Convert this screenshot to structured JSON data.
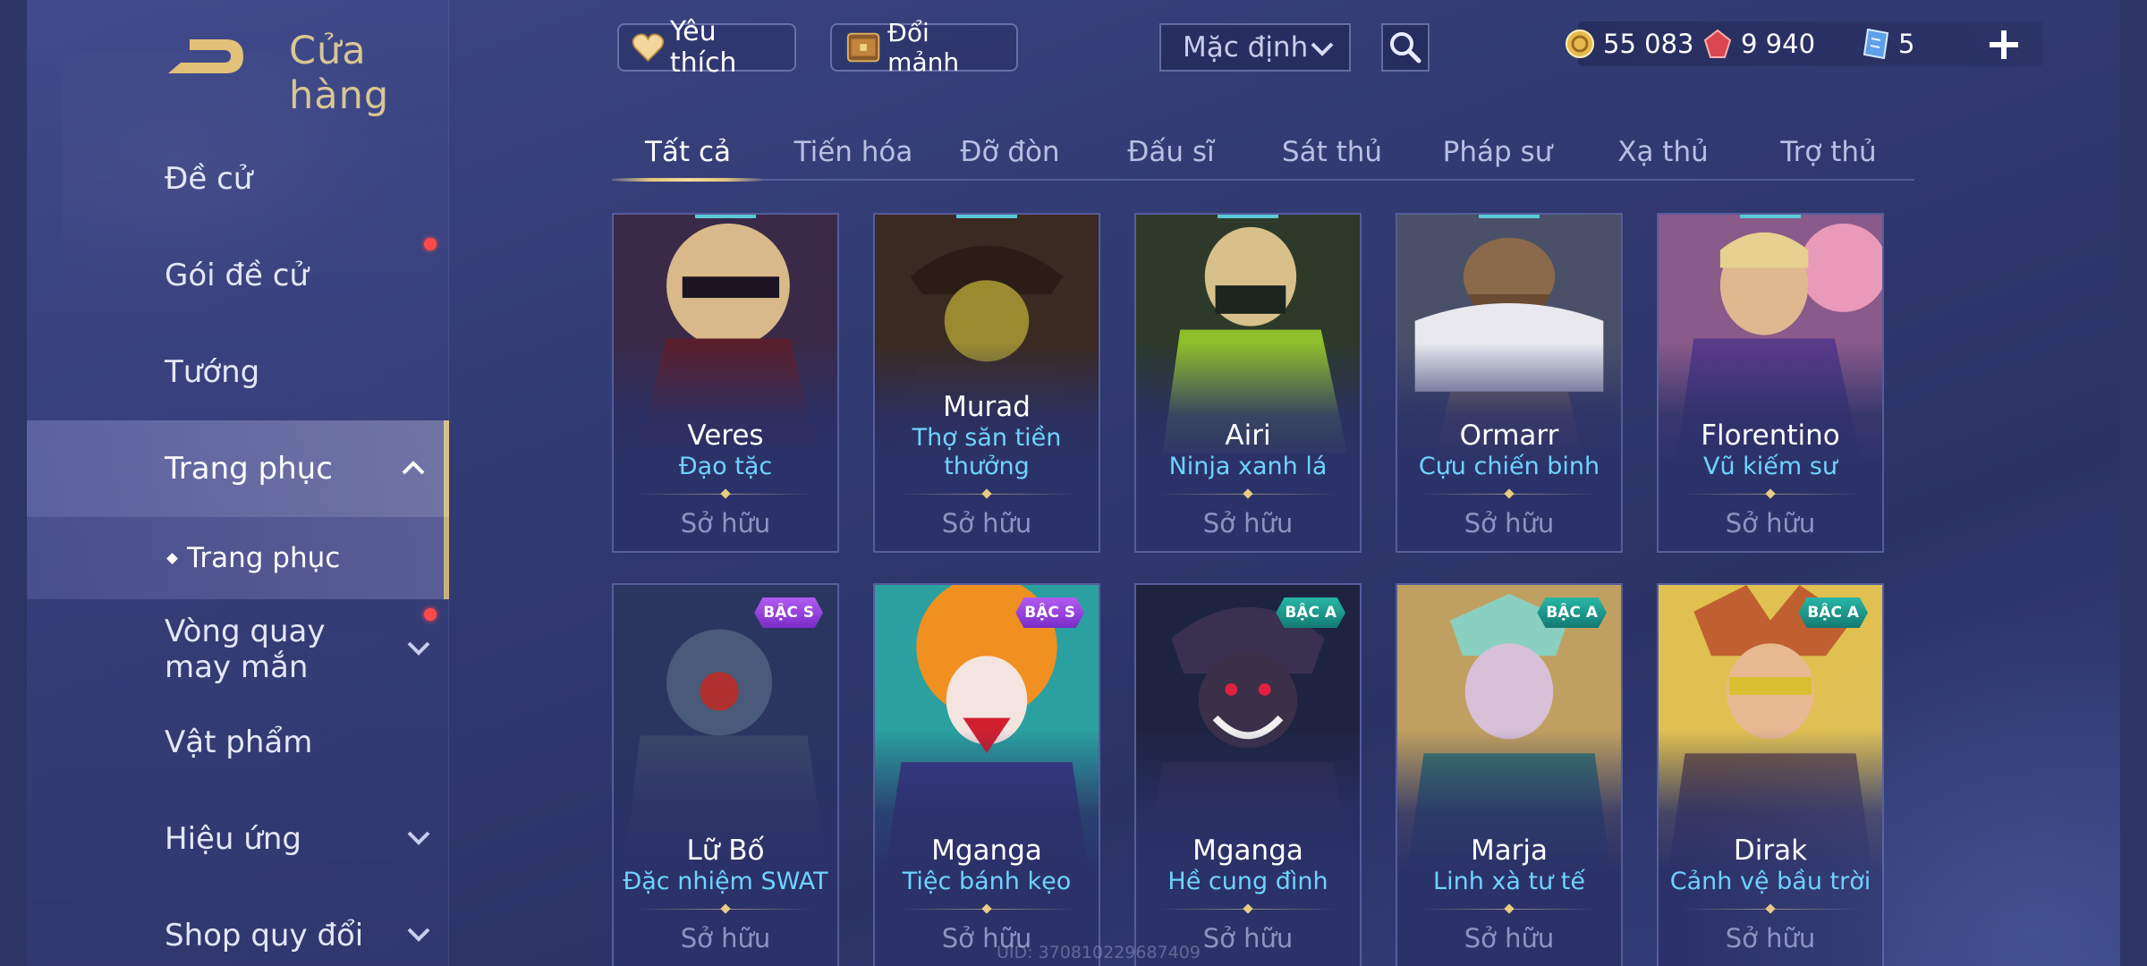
{
  "header": {
    "title": "Cửa hàng"
  },
  "sidebar": {
    "items": [
      {
        "label": "Đề cử"
      },
      {
        "label": "Gói đề cử"
      },
      {
        "label": "Tướng"
      },
      {
        "label": "Trang phục"
      },
      {
        "label": "Vòng quay may mắn"
      },
      {
        "label": "Vật phẩm"
      },
      {
        "label": "Hiệu ứng"
      },
      {
        "label": "Shop quy đổi"
      }
    ],
    "sub_item": {
      "label": "Trang phục"
    },
    "active": "Trang phục"
  },
  "toolbar": {
    "favorite_label": "Yêu thích",
    "shard_label": "Đổi mảnh",
    "sort_value": "Mặc định"
  },
  "currencies": [
    {
      "icon": "gold-coin-icon",
      "value": "55 083"
    },
    {
      "icon": "ruby-gem-icon",
      "value": "9 940"
    },
    {
      "icon": "ticket-card-icon",
      "value": "5"
    }
  ],
  "tabs": [
    {
      "label": "Tất cả"
    },
    {
      "label": "Tiến hóa"
    },
    {
      "label": "Đỡ đòn"
    },
    {
      "label": "Đấu sĩ"
    },
    {
      "label": "Sát thủ"
    },
    {
      "label": "Pháp sư"
    },
    {
      "label": "Xạ thủ"
    },
    {
      "label": "Trợ thủ"
    }
  ],
  "cards": [
    {
      "hero": "Veres",
      "skin": "Đạo tặc",
      "status": "Sở hữu"
    },
    {
      "hero": "Murad",
      "skin": "Thợ săn tiền thưởng",
      "status": "Sở hữu"
    },
    {
      "hero": "Airi",
      "skin": "Ninja xanh lá",
      "status": "Sở hữu"
    },
    {
      "hero": "Ormarr",
      "skin": "Cựu chiến binh",
      "status": "Sở hữu"
    },
    {
      "hero": "Florentino",
      "skin": "Vũ kiếm sư",
      "status": "Sở hữu"
    },
    {
      "hero": "Lữ Bố",
      "skin": "Đặc nhiệm SWAT",
      "status": "Sở hữu",
      "tier": "BẬC S"
    },
    {
      "hero": "Mganga",
      "skin": "Tiệc bánh kẹo",
      "status": "Sở hữu",
      "tier": "BẬC S"
    },
    {
      "hero": "Mganga",
      "skin": "Hề cung đình",
      "status": "Sở hữu",
      "tier": "BẬC A"
    },
    {
      "hero": "Marja",
      "skin": "Linh xà tư tế",
      "status": "Sở hữu",
      "tier": "BẬC A"
    },
    {
      "hero": "Dirak",
      "skin": "Cảnh vệ bầu trời",
      "status": "Sở hữu",
      "tier": "BẬC A"
    }
  ],
  "footer": {
    "uid": "UID: 370810229687409"
  },
  "colors": {
    "accent_gold": "#d9c694",
    "skin_name": "#6fd3ff",
    "tier_s": "#9a44e0",
    "tier_a": "#1f9a8c",
    "notify": "#ff4a4a"
  }
}
